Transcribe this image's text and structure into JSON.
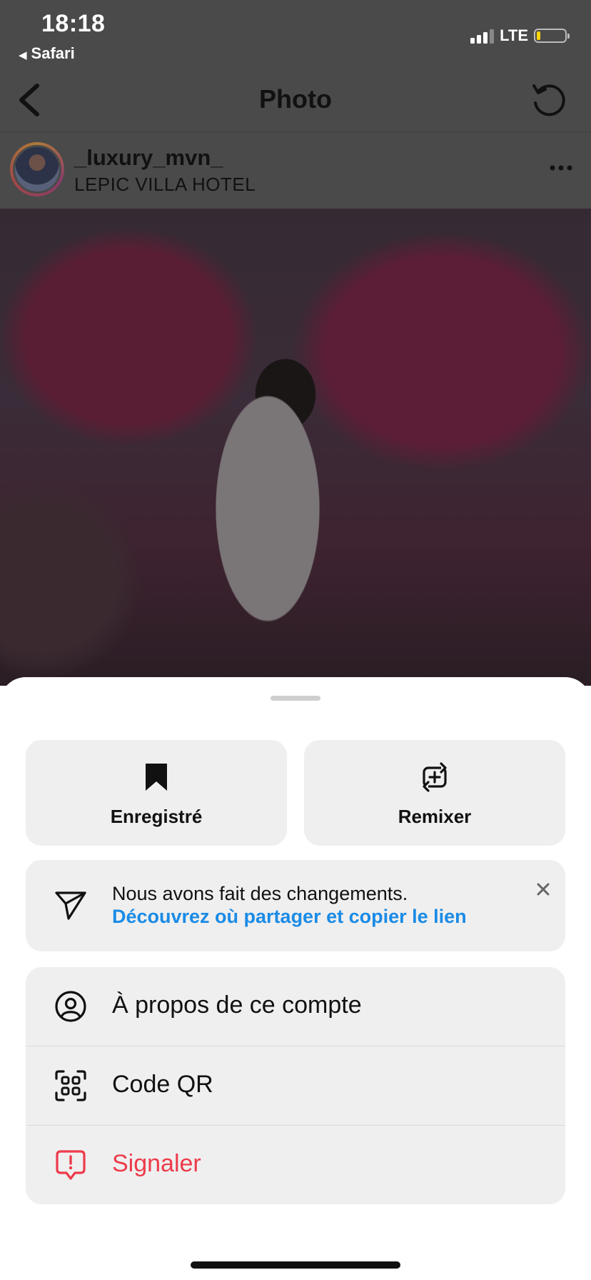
{
  "status_bar": {
    "time": "18:18",
    "back_app": "Safari",
    "network": "LTE",
    "battery_color": "#ffd60a"
  },
  "nav": {
    "title": "Photo",
    "back_icon": "chevron-left-icon",
    "refresh_icon": "refresh-icon"
  },
  "post": {
    "username": "_luxury_mvn_",
    "location": "LEPIC VILLA HOTEL",
    "more_icon": "ellipsis-icon"
  },
  "sheet": {
    "actions": [
      {
        "label": "Enregistré",
        "icon": "bookmark-filled-icon"
      },
      {
        "label": "Remixer",
        "icon": "remix-icon"
      }
    ],
    "banner": {
      "message": "Nous avons fait des changements.",
      "link": "Découvrez où partager et copier le lien",
      "icon": "send-icon",
      "link_color": "#1a8be6"
    },
    "menu": [
      {
        "label": "À propos de ce compte",
        "icon": "account-icon"
      },
      {
        "label": "Code QR",
        "icon": "qr-code-icon"
      },
      {
        "label": "Signaler",
        "icon": "report-icon",
        "color": "#ed3b4b"
      }
    ]
  }
}
